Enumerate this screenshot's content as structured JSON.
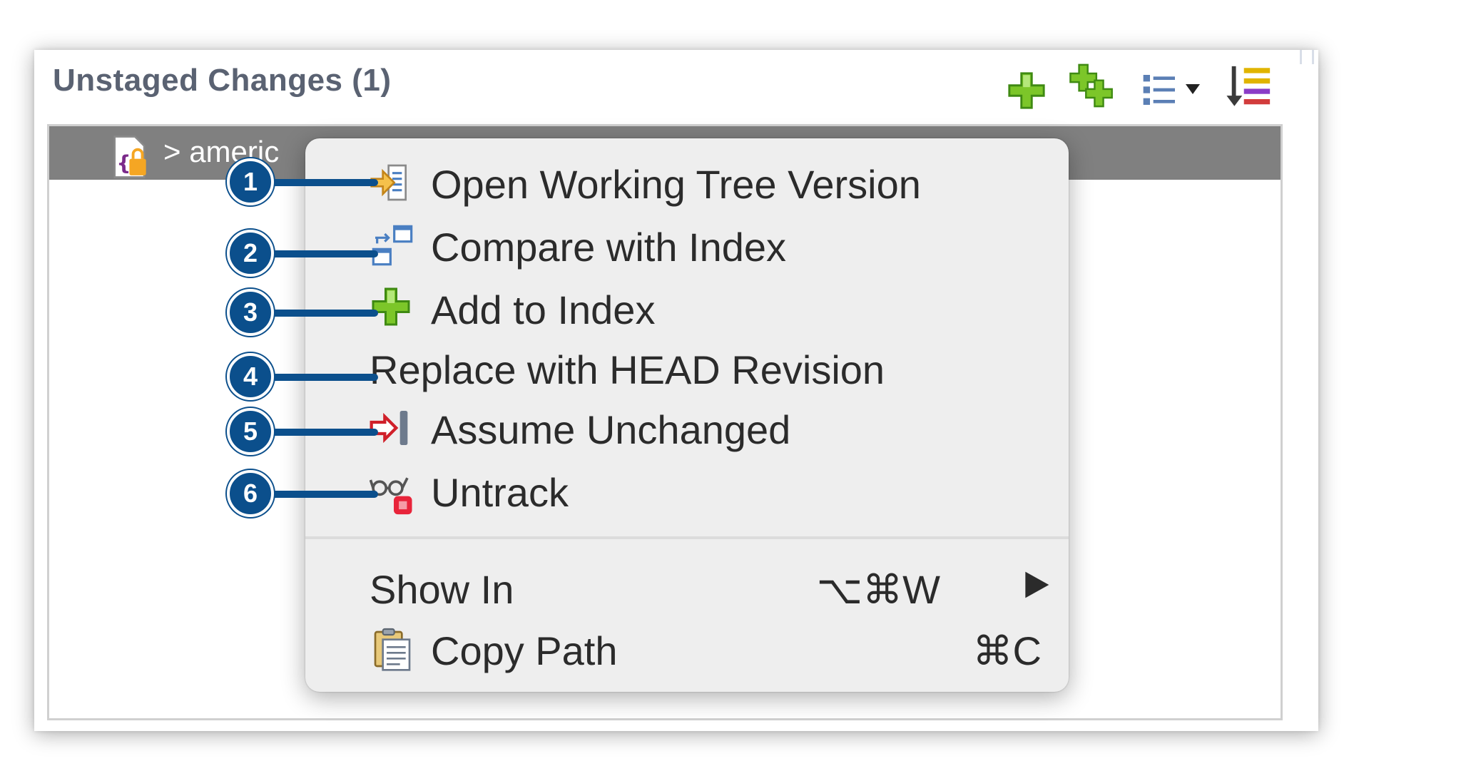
{
  "panel": {
    "title": "Unstaged Changes (1)",
    "toolbar": {
      "stage_icon": "add-plus-icon",
      "stage_all_icon": "add-all-icon",
      "presentation_icon": "list-view-icon",
      "sort_icon": "sort-icon"
    }
  },
  "tree": {
    "row_label": "> americ"
  },
  "context_menu": {
    "items": [
      {
        "label": "Open Working Tree Version",
        "icon": "open-file-arrow-icon"
      },
      {
        "label": "Compare with Index",
        "icon": "compare-icon"
      },
      {
        "label": "Add to Index",
        "icon": "add-plus-icon"
      },
      {
        "label": "Replace with HEAD Revision",
        "icon": ""
      },
      {
        "label": "Assume Unchanged",
        "icon": "assume-unchanged-icon"
      },
      {
        "label": "Untrack",
        "icon": "untrack-glasses-icon"
      },
      {
        "label": "Show In",
        "shortcut": "⌥⌘W",
        "icon": ""
      },
      {
        "label": "Copy Path",
        "shortcut": "⌘C",
        "icon": "clipboard-icon"
      }
    ]
  },
  "callouts": [
    "1",
    "2",
    "3",
    "4",
    "5",
    "6"
  ],
  "colors": {
    "callout": "#0b4f8c",
    "tree_selection": "#808080",
    "menu_bg": "#eeeeee",
    "title": "#5a6272"
  }
}
